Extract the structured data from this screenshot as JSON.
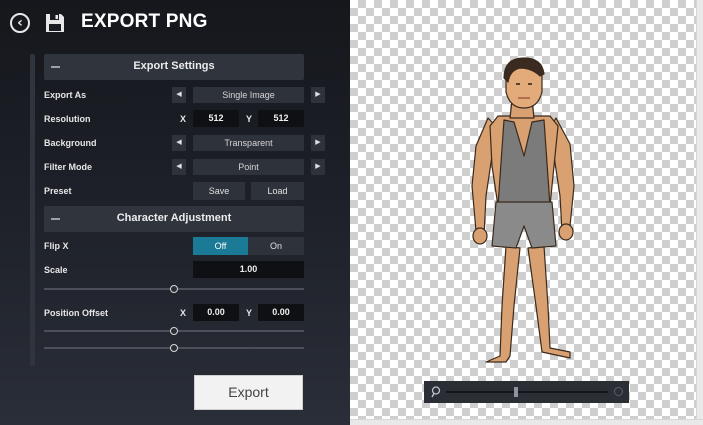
{
  "header": {
    "title": "EXPORT PNG",
    "back_icon": "back-arrow-icon",
    "save_icon": "floppy-disk-icon"
  },
  "export_settings": {
    "title": "Export Settings",
    "export_as": {
      "label": "Export As",
      "value": "Single Image"
    },
    "resolution": {
      "label": "Resolution",
      "x_label": "X",
      "x_value": "512",
      "y_label": "Y",
      "y_value": "512"
    },
    "background": {
      "label": "Background",
      "value": "Transparent"
    },
    "filter_mode": {
      "label": "Filter Mode",
      "value": "Point"
    },
    "preset": {
      "label": "Preset",
      "save_label": "Save",
      "load_label": "Load"
    }
  },
  "character_adjustment": {
    "title": "Character Adjustment",
    "flip_x": {
      "label": "Flip X",
      "off_label": "Off",
      "on_label": "On",
      "selected": "Off"
    },
    "scale": {
      "label": "Scale",
      "value": "1.00",
      "slider_fraction": 0.5
    },
    "position_offset": {
      "label": "Position Offset",
      "x_label": "X",
      "x_value": "0.00",
      "y_label": "Y",
      "y_value": "0.00",
      "x_slider_fraction": 0.5,
      "y_slider_fraction": 0.5
    }
  },
  "export_button": {
    "label": "Export"
  },
  "preview": {
    "zoom_fraction": 0.42,
    "accent_color": "#1b7b96"
  }
}
